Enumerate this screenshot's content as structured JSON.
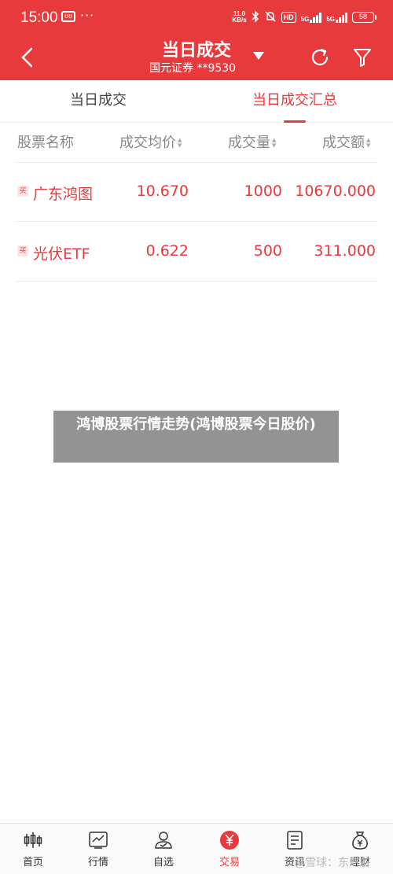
{
  "status_bar": {
    "time": "15:00",
    "notif_icon_text": "ʊʊ",
    "more": "···",
    "net_speed_top": "11.0",
    "net_speed_bottom": "KB/s",
    "hd": "HD",
    "sig1": "5G",
    "sig2": "5G",
    "battery": "58"
  },
  "header": {
    "title": "当日成交",
    "account": "国元证券 **9530"
  },
  "tabs": [
    {
      "label": "当日成交"
    },
    {
      "label": "当日成交汇总"
    }
  ],
  "table": {
    "columns": [
      "股票名称",
      "成交均价",
      "成交量",
      "成交额"
    ],
    "rows": [
      {
        "tag": "买",
        "name": "广东鸿图",
        "avg_price": "10.670",
        "volume": "1000",
        "amount": "10670.000"
      },
      {
        "tag": "买",
        "name": "光伏ETF",
        "avg_price": "0.622",
        "volume": "500",
        "amount": "311.000"
      }
    ]
  },
  "overlay": {
    "text": "鸿博股票行情走势(鸿博股票今日股价)"
  },
  "bottom_nav": [
    {
      "label": "首页",
      "icon": "candlestick-icon"
    },
    {
      "label": "行情",
      "icon": "chart-icon"
    },
    {
      "label": "自选",
      "icon": "user-check-icon"
    },
    {
      "label": "交易",
      "icon": "yuan-icon"
    },
    {
      "label": "资讯",
      "icon": "document-icon"
    },
    {
      "label": "理财",
      "icon": "money-bag-icon"
    }
  ],
  "watermark": "@雪球：东财谷",
  "colors": {
    "accent": "#e83a3c"
  }
}
